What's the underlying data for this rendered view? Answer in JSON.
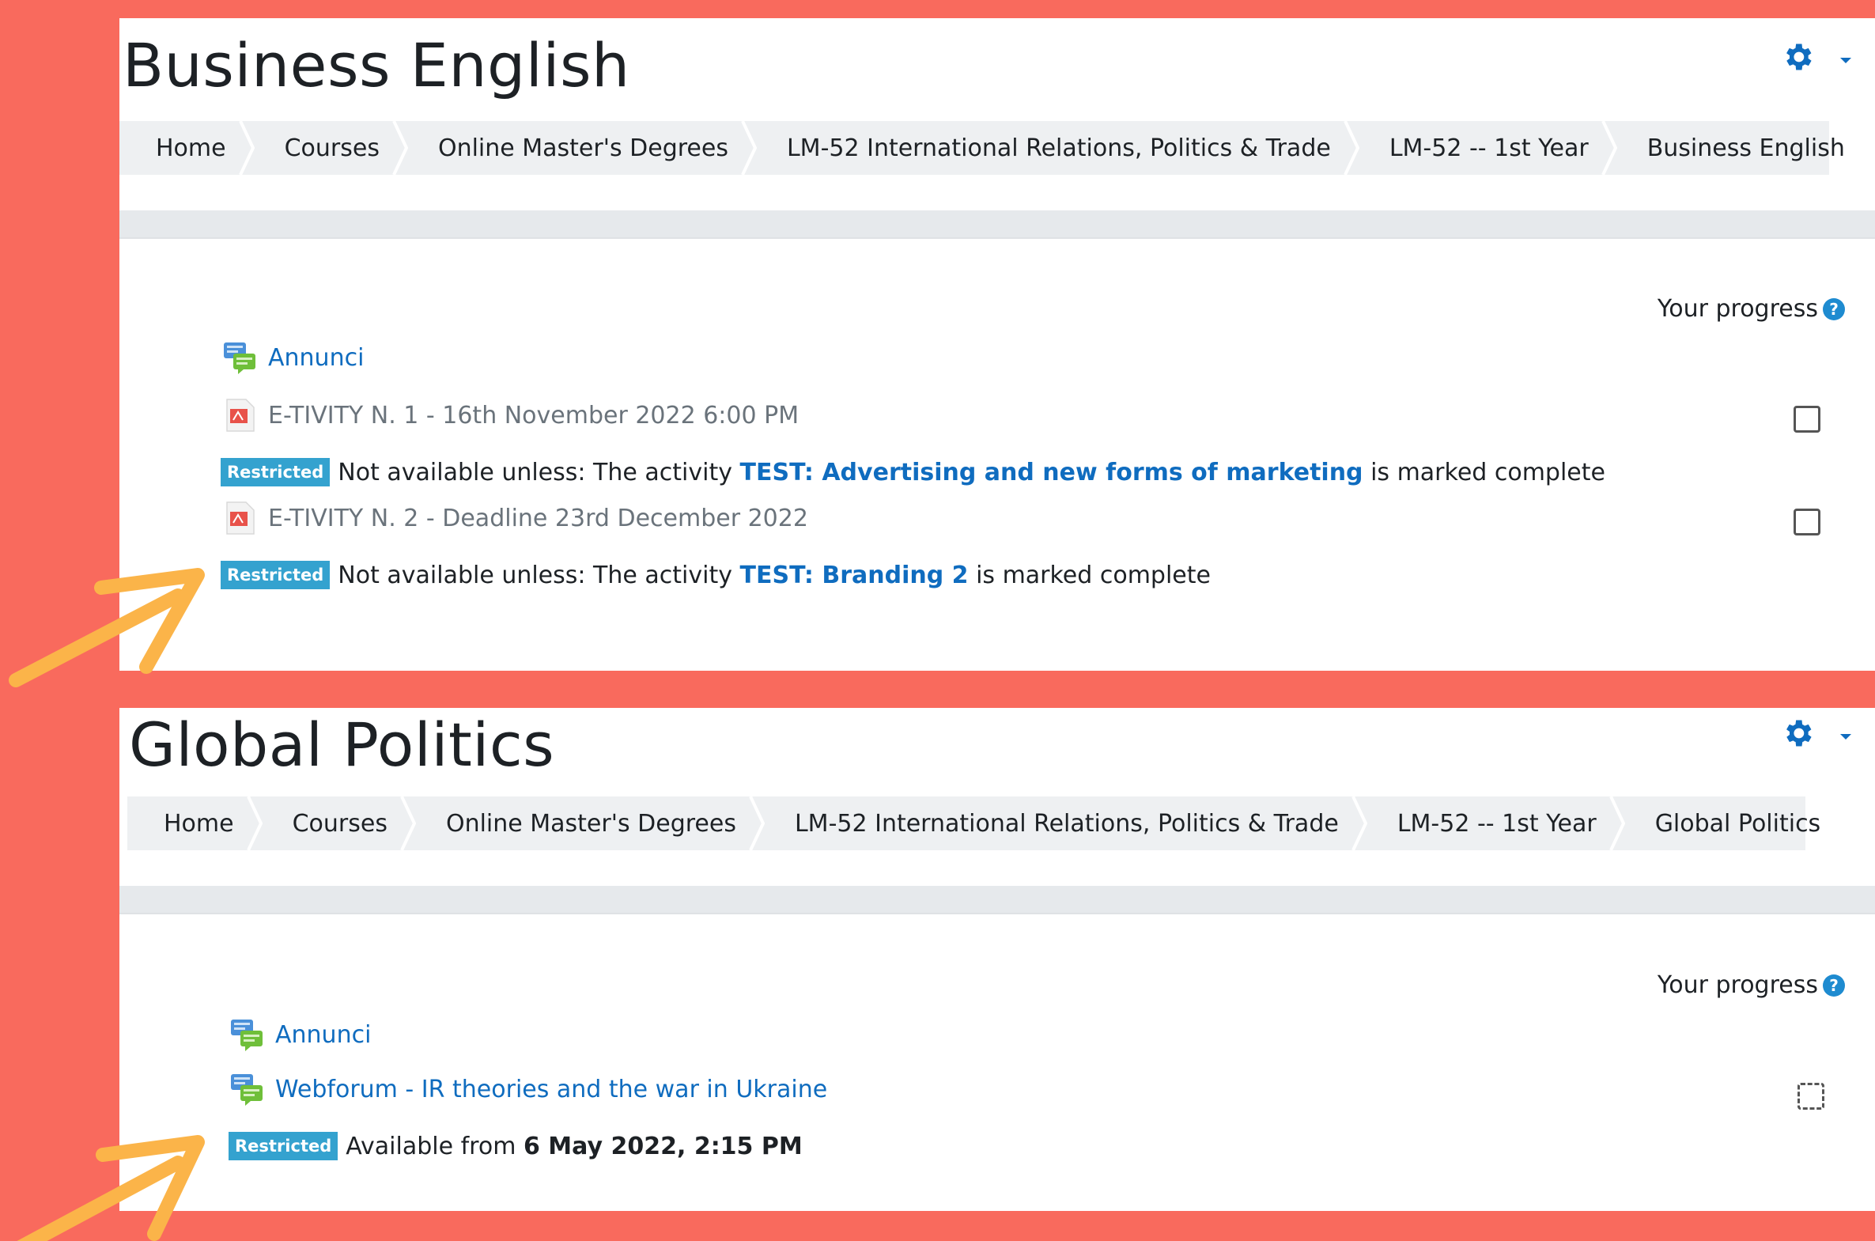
{
  "course1": {
    "title": "Business English",
    "breadcrumb": [
      "Home",
      "Courses",
      "Online Master's Degrees",
      "LM-52 International Relations, Politics & Trade",
      "LM-52 -- 1st Year",
      "Business English"
    ],
    "progress_label": "Your progress",
    "help_glyph": "?",
    "activities": [
      {
        "name": "Annunci",
        "icon": "forum-icon"
      },
      {
        "name": "E-TIVITY N. 1 - 16th November 2022 6:00 PM",
        "icon": "pdf-icon"
      },
      {
        "name": "E-TIVITY N. 2 - Deadline 23rd December 2022",
        "icon": "pdf-icon"
      }
    ],
    "restrictions": [
      {
        "badge": "Restricted",
        "prefix": "Not available unless: The activity",
        "link": "TEST: Advertising and new forms of marketing",
        "suffix": "is marked complete"
      },
      {
        "badge": "Restricted",
        "prefix": "Not available unless: The activity",
        "link": "TEST: Branding 2",
        "suffix": "is marked complete"
      }
    ]
  },
  "course2": {
    "title": "Global Politics",
    "breadcrumb": [
      "Home",
      "Courses",
      "Online Master's Degrees",
      "LM-52 International Relations, Politics & Trade",
      "LM-52 -- 1st Year",
      "Global Politics"
    ],
    "progress_label": "Your progress",
    "help_glyph": "?",
    "activities": [
      {
        "name": "Annunci",
        "icon": "forum-icon"
      },
      {
        "name": "Webforum - IR theories and the war in Ukraine",
        "icon": "forum-icon"
      }
    ],
    "restriction": {
      "badge": "Restricted",
      "prefix": "Available from",
      "date": "6 May 2022, 2:15 PM"
    }
  },
  "colors": {
    "background": "#f96a5d",
    "link": "#0f6cbf",
    "badge": "#34a2cf",
    "arrow": "#fbb449"
  },
  "icons": [
    "gear-icon",
    "help-icon",
    "forum-icon",
    "pdf-icon",
    "arrow-icon",
    "checkbox-icon"
  ]
}
